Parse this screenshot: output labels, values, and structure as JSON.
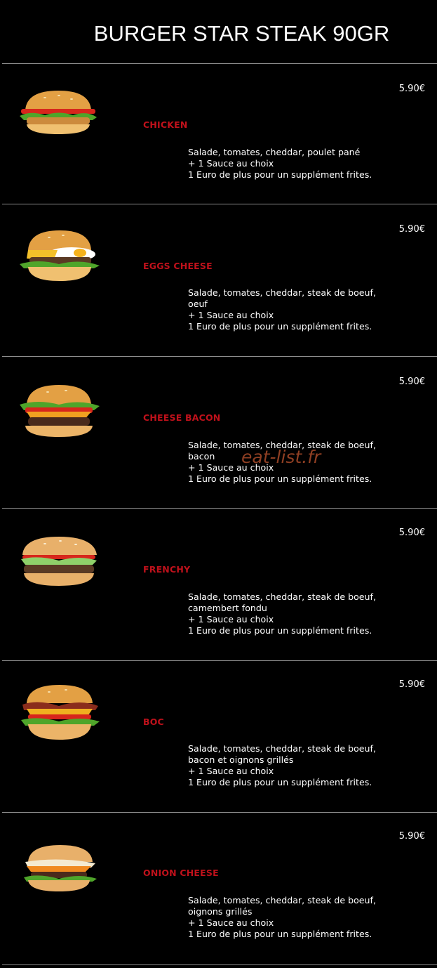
{
  "header": {
    "title": "BURGER STAR STEAK 90GR"
  },
  "items": [
    {
      "name": "CHICKEN",
      "price": "5.90€",
      "desc": [
        "Salade, tomates, cheddar, poulet pané",
        "+ 1 Sauce au choix",
        "1 Euro de plus pour un supplément frites."
      ],
      "image": "chicken-burger-image"
    },
    {
      "name": "EGGS CHEESE",
      "price": "5.90€",
      "desc": [
        "Salade, tomates, cheddar, steak de boeuf,",
        "oeuf",
        "+ 1 Sauce au choix",
        "1 Euro de plus pour un supplément frites."
      ],
      "image": "egg-burger-image"
    },
    {
      "name": "CHEESE BACON",
      "price": "5.90€",
      "desc": [
        "Salade, tomates, cheddar, steak de boeuf,",
        "bacon",
        "+ 1 Sauce au choix",
        "1 Euro de plus pour un supplément frites."
      ],
      "image": "bacon-burger-image"
    },
    {
      "name": "FRENCHY",
      "price": "5.90€",
      "desc": [
        "Salade, tomates, cheddar, steak de boeuf,",
        "camembert fondu",
        "+ 1 Sauce au choix",
        "1 Euro de plus pour un supplément frites."
      ],
      "image": "frenchy-burger-image"
    },
    {
      "name": "BOC",
      "price": "5.90€",
      "desc": [
        "Salade, tomates, cheddar, steak de boeuf,",
        "bacon et oignons grillés",
        "+ 1 Sauce au choix",
        "1 Euro de plus pour un supplément frites."
      ],
      "image": "boc-burger-image"
    },
    {
      "name": "ONION CHEESE",
      "price": "5.90€",
      "desc": [
        "Salade, tomates, cheddar, steak de boeuf,",
        "oignons grillés",
        "+ 1 Sauce au choix",
        "1 Euro de plus pour un supplément frites."
      ],
      "image": "onion-burger-image"
    }
  ],
  "watermark": "eat-list.fr",
  "colors": {
    "background": "#000000",
    "item_name": "#c0111b",
    "divider": "#8c8c8c"
  }
}
